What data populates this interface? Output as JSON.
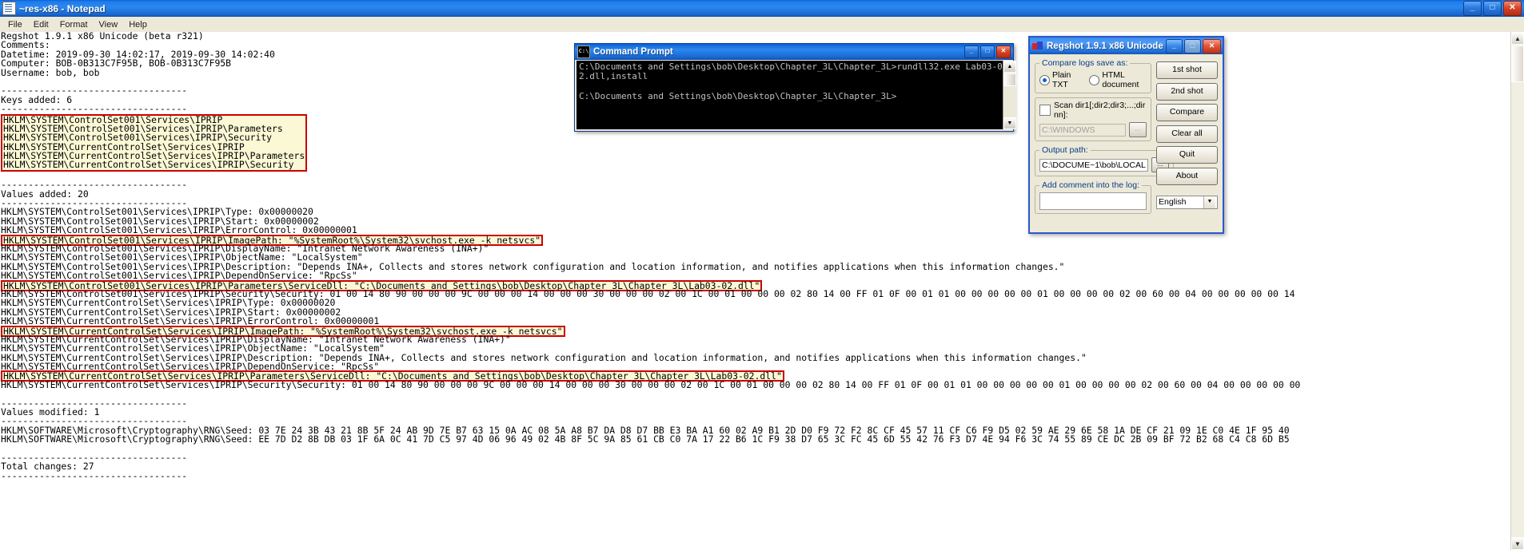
{
  "notepad": {
    "title": "~res-x86 - Notepad",
    "menu": [
      "File",
      "Edit",
      "Format",
      "View",
      "Help"
    ],
    "buttons": {
      "minimize": "_",
      "maximize": "□",
      "close": "✕"
    },
    "header_lines": [
      "Regshot 1.9.1 x86 Unicode (beta r321)",
      "Comments:",
      "Datetime: 2019-09-30 14:02:17, 2019-09-30 14:02:40",
      "Computer: BOB-0B313C7F95B, BOB-0B313C7F95B",
      "Username: bob, bob",
      "",
      "----------------------------------",
      "Keys added: 6",
      "----------------------------------"
    ],
    "keys_added_block": [
      "HKLM\\SYSTEM\\ControlSet001\\Services\\IPRIP",
      "HKLM\\SYSTEM\\ControlSet001\\Services\\IPRIP\\Parameters",
      "HKLM\\SYSTEM\\ControlSet001\\Services\\IPRIP\\Security",
      "HKLM\\SYSTEM\\CurrentControlSet\\Services\\IPRIP",
      "HKLM\\SYSTEM\\CurrentControlSet\\Services\\IPRIP\\Parameters",
      "HKLM\\SYSTEM\\CurrentControlSet\\Services\\IPRIP\\Security"
    ],
    "values_added_header": [
      "",
      "----------------------------------",
      "Values added: 20",
      "----------------------------------"
    ],
    "values_added_lines": [
      {
        "text": "HKLM\\SYSTEM\\ControlSet001\\Services\\IPRIP\\Type: 0x00000020",
        "highlight": false
      },
      {
        "text": "HKLM\\SYSTEM\\ControlSet001\\Services\\IPRIP\\Start: 0x00000002",
        "highlight": false
      },
      {
        "text": "HKLM\\SYSTEM\\ControlSet001\\Services\\IPRIP\\ErrorControl: 0x00000001",
        "highlight": false
      },
      {
        "text": "HKLM\\SYSTEM\\ControlSet001\\Services\\IPRIP\\ImagePath: \"%SystemRoot%\\System32\\svchost.exe -k netsvcs\"",
        "highlight": true
      },
      {
        "text": "HKLM\\SYSTEM\\ControlSet001\\Services\\IPRIP\\DisplayName: \"Intranet Network Awareness (INA+)\"",
        "highlight": false
      },
      {
        "text": "HKLM\\SYSTEM\\ControlSet001\\Services\\IPRIP\\ObjectName: \"LocalSystem\"",
        "highlight": false
      },
      {
        "text": "HKLM\\SYSTEM\\ControlSet001\\Services\\IPRIP\\Description: \"Depends INA+, Collects and stores network configuration and location information, and notifies applications when this information changes.\"",
        "highlight": false
      },
      {
        "text": "HKLM\\SYSTEM\\ControlSet001\\Services\\IPRIP\\DependOnService: \"RpcSs\"",
        "highlight": false
      },
      {
        "text": "HKLM\\SYSTEM\\ControlSet001\\Services\\IPRIP\\Parameters\\ServiceDll: \"C:\\Documents and Settings\\bob\\Desktop\\Chapter_3L\\Chapter_3L\\Lab03-02.dll\"",
        "highlight": true
      },
      {
        "text": "HKLM\\SYSTEM\\ControlSet001\\Services\\IPRIP\\Security\\Security: 01 00 14 80 90 00 00 00 9C 00 00 00 14 00 00 00 30 00 00 00 02 00 1C 00 01 00 00 00 02 80 14 00 FF 01 0F 00 01 01 00 00 00 00 00 01 00 00 00 00 02 00 60 00 04 00 00 00 00 00 14",
        "highlight": false
      },
      {
        "text": "HKLM\\SYSTEM\\CurrentControlSet\\Services\\IPRIP\\Type: 0x00000020",
        "highlight": false
      },
      {
        "text": "HKLM\\SYSTEM\\CurrentControlSet\\Services\\IPRIP\\Start: 0x00000002",
        "highlight": false
      },
      {
        "text": "HKLM\\SYSTEM\\CurrentControlSet\\Services\\IPRIP\\ErrorControl: 0x00000001",
        "highlight": false
      },
      {
        "text": "HKLM\\SYSTEM\\CurrentControlSet\\Services\\IPRIP\\ImagePath: \"%SystemRoot%\\System32\\svchost.exe -k netsvcs\"",
        "highlight": true
      },
      {
        "text": "HKLM\\SYSTEM\\CurrentControlSet\\Services\\IPRIP\\DisplayName: \"Intranet Network Awareness (INA+)\"",
        "highlight": false
      },
      {
        "text": "HKLM\\SYSTEM\\CurrentControlSet\\Services\\IPRIP\\ObjectName: \"LocalSystem\"",
        "highlight": false
      },
      {
        "text": "HKLM\\SYSTEM\\CurrentControlSet\\Services\\IPRIP\\Description: \"Depends INA+, Collects and stores network configuration and location information, and notifies applications when this information changes.\"",
        "highlight": false
      },
      {
        "text": "HKLM\\SYSTEM\\CurrentControlSet\\Services\\IPRIP\\DependOnService: \"RpcSs\"",
        "highlight": false
      },
      {
        "text": "HKLM\\SYSTEM\\CurrentControlSet\\Services\\IPRIP\\Parameters\\ServiceDll: \"C:\\Documents and Settings\\bob\\Desktop\\Chapter_3L\\Chapter_3L\\Lab03-02.dll\"",
        "highlight": true
      },
      {
        "text": "HKLM\\SYSTEM\\CurrentControlSet\\Services\\IPRIP\\Security\\Security: 01 00 14 80 90 00 00 00 9C 00 00 00 14 00 00 00 30 00 00 00 02 00 1C 00 01 00 00 00 02 80 14 00 FF 01 0F 00 01 01 00 00 00 00 00 01 00 00 00 00 02 00 60 00 04 00 00 00 00 00",
        "highlight": false
      }
    ],
    "values_modified_header": [
      "",
      "----------------------------------",
      "Values modified: 1",
      "----------------------------------"
    ],
    "values_modified_lines": [
      "HKLM\\SOFTWARE\\Microsoft\\Cryptography\\RNG\\Seed: 03 7E 24 3B 43 21 8B 5F 24 AB 9D 7E B7 63 15 0A AC 08 5A A8 B7 DA D8 D7 BB E3 BA A1 60 02 A9 B1 2D D0 F9 72 F2 8C CF 45 57 11 CF C6 F9 D5 02 59 AE 29 6E 58 1A DE CF 21 09 1E C0 4E 1F 95 40",
      "HKLM\\SOFTWARE\\Microsoft\\Cryptography\\RNG\\Seed: EE 7D D2 8B DB 03 1F 6A 0C 41 7D C5 97 4D 06 96 49 02 4B 8F 5C 9A 85 61 CB C0 7A 17 22 B6 1C F9 38 D7 65 3C FC 45 6D 55 42 76 F3 D7 4E 94 F6 3C 74 55 89 CE DC 2B 09 BF 72 B2 68 C4 C8 6D B5"
    ],
    "footer_lines": [
      "",
      "----------------------------------",
      "Total changes: 27",
      "----------------------------------"
    ],
    "scrollbar": {
      "up_arrow": "▲",
      "down_arrow": "▼"
    }
  },
  "command_prompt": {
    "title": "Command Prompt",
    "icon_label": "C:\\",
    "buttons": {
      "minimize": "_",
      "maximize": "□",
      "close": "✕"
    },
    "console_text": "C:\\Documents and Settings\\bob\\Desktop\\Chapter_3L\\Chapter_3L>rundll32.exe Lab03-0\n2.dll,install\n\nC:\\Documents and Settings\\bob\\Desktop\\Chapter_3L\\Chapter_3L>",
    "scrollbar": {
      "up_arrow": "▲",
      "down_arrow": "▼"
    }
  },
  "regshot": {
    "title": "Regshot 1.9.1 x86 Unicode (...",
    "buttons": {
      "minimize": "_",
      "maximize": "□",
      "close": "✕"
    },
    "compare_group_label": "Compare logs save as:",
    "radio_plain_txt": "Plain TXT",
    "radio_html_document": "HTML document",
    "radio_selected": "Plain TXT",
    "scan_dir_label": "Scan dir1[;dir2;dir3;...;dir nn]:",
    "scan_dir_checked": false,
    "scan_dir_value": "C:\\WINDOWS",
    "browse_label": "...",
    "output_path_label": "Output path:",
    "output_path_value": "C:\\DOCUME~1\\bob\\LOCAL",
    "comment_label": "Add comment into the log:",
    "comment_value": "",
    "language_selected": "English",
    "language_arrow": "▼",
    "action_buttons": [
      "1st shot",
      "2nd shot",
      "Compare",
      "Clear all",
      "Quit",
      "About"
    ],
    "accent_color": "#0b3c8c",
    "highlight_border_color": "#cc0000",
    "highlight_fill_color": "#fbf9d5"
  }
}
